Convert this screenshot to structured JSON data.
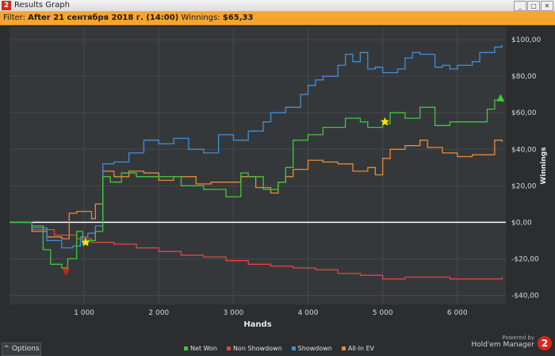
{
  "window": {
    "app_icon": "2",
    "title": "Results Graph",
    "buttons": [
      "_",
      "□",
      "✕"
    ]
  },
  "filter": {
    "label": "Filter:",
    "value": "After 21 сентября 2018 г. (14:00)",
    "winnings_label": "Winnings:",
    "winnings_value": "$65,33"
  },
  "bottom": {
    "options_label": "^ Options",
    "powered_by": "Powered by",
    "powered_name": "Hold'em Manager",
    "logo_glyph": "2"
  },
  "chart_data": {
    "type": "line",
    "xlabel": "Hands",
    "ylabel": "Winnings",
    "xlim": [
      0,
      6650
    ],
    "ylim": [
      -45,
      107
    ],
    "x_ticks": [
      1000,
      2000,
      3000,
      4000,
      5000,
      6000
    ],
    "x_tick_labels": [
      "1 000",
      "2 000",
      "3 000",
      "4 000",
      "5 000",
      "6 000"
    ],
    "y_ticks": [
      100,
      80,
      60,
      40,
      20,
      0,
      -20,
      -40
    ],
    "y_tick_labels": [
      "$100,00",
      "$80,00",
      "$60,00",
      "$40,00",
      "$20,00",
      "$0,00",
      "-$20,00",
      "-$40,00"
    ],
    "grid": true,
    "zero_line": true,
    "legend_position": "bottom",
    "series": [
      {
        "name": "Net Won",
        "color": "#3ec83a",
        "points": [
          [
            0,
            0
          ],
          [
            300,
            -2
          ],
          [
            450,
            -15
          ],
          [
            550,
            -23
          ],
          [
            700,
            -25
          ],
          [
            780,
            -20
          ],
          [
            900,
            -5
          ],
          [
            980,
            -12
          ],
          [
            1050,
            -10
          ],
          [
            1150,
            -5
          ],
          [
            1250,
            25
          ],
          [
            1350,
            22
          ],
          [
            1500,
            27
          ],
          [
            1700,
            25
          ],
          [
            2000,
            25
          ],
          [
            2300,
            20
          ],
          [
            2600,
            18
          ],
          [
            2900,
            14
          ],
          [
            3100,
            27
          ],
          [
            3200,
            25
          ],
          [
            3400,
            18
          ],
          [
            3600,
            22
          ],
          [
            3700,
            30
          ],
          [
            3800,
            45
          ],
          [
            4000,
            48
          ],
          [
            4200,
            52
          ],
          [
            4500,
            57
          ],
          [
            4700,
            55
          ],
          [
            4800,
            52
          ],
          [
            5000,
            54
          ],
          [
            5100,
            60
          ],
          [
            5300,
            57
          ],
          [
            5500,
            63
          ],
          [
            5700,
            53
          ],
          [
            5900,
            55
          ],
          [
            6200,
            55
          ],
          [
            6400,
            62
          ],
          [
            6500,
            67
          ],
          [
            6600,
            66
          ]
        ]
      },
      {
        "name": "Non Showdown",
        "color": "#e2463e",
        "points": [
          [
            0,
            0
          ],
          [
            300,
            -4
          ],
          [
            600,
            -7
          ],
          [
            900,
            -9
          ],
          [
            1100,
            -11
          ],
          [
            1400,
            -12
          ],
          [
            1700,
            -14
          ],
          [
            2000,
            -16
          ],
          [
            2300,
            -18
          ],
          [
            2600,
            -19
          ],
          [
            2900,
            -21
          ],
          [
            3200,
            -23
          ],
          [
            3500,
            -24
          ],
          [
            3800,
            -25
          ],
          [
            4100,
            -26
          ],
          [
            4400,
            -28
          ],
          [
            4700,
            -29
          ],
          [
            5000,
            -31
          ],
          [
            5300,
            -30
          ],
          [
            5600,
            -30
          ],
          [
            5900,
            -31
          ],
          [
            6200,
            -31
          ],
          [
            6400,
            -31
          ],
          [
            6600,
            -30
          ]
        ]
      },
      {
        "name": "Showdown",
        "color": "#3f8fd6",
        "points": [
          [
            0,
            0
          ],
          [
            300,
            -3
          ],
          [
            500,
            -10
          ],
          [
            700,
            -14
          ],
          [
            850,
            -13
          ],
          [
            950,
            -8
          ],
          [
            1050,
            -6
          ],
          [
            1150,
            -2
          ],
          [
            1250,
            32
          ],
          [
            1400,
            33
          ],
          [
            1600,
            38
          ],
          [
            1800,
            45
          ],
          [
            2000,
            43
          ],
          [
            2200,
            46
          ],
          [
            2400,
            40
          ],
          [
            2600,
            38
          ],
          [
            2800,
            48
          ],
          [
            3000,
            45
          ],
          [
            3200,
            50
          ],
          [
            3400,
            55
          ],
          [
            3500,
            60
          ],
          [
            3700,
            63
          ],
          [
            3900,
            70
          ],
          [
            4000,
            75
          ],
          [
            4100,
            78
          ],
          [
            4200,
            80
          ],
          [
            4400,
            86
          ],
          [
            4500,
            92
          ],
          [
            4600,
            88
          ],
          [
            4700,
            93
          ],
          [
            4800,
            84
          ],
          [
            4900,
            85
          ],
          [
            5000,
            82
          ],
          [
            5200,
            84
          ],
          [
            5300,
            90
          ],
          [
            5400,
            93
          ],
          [
            5500,
            92
          ],
          [
            5700,
            85
          ],
          [
            5800,
            86
          ],
          [
            5900,
            84
          ],
          [
            6000,
            86
          ],
          [
            6200,
            88
          ],
          [
            6300,
            93
          ],
          [
            6500,
            96
          ],
          [
            6600,
            97
          ]
        ]
      },
      {
        "name": "All-In EV",
        "color": "#e88a3a",
        "points": [
          [
            0,
            0
          ],
          [
            300,
            -5
          ],
          [
            500,
            -8
          ],
          [
            700,
            -9
          ],
          [
            800,
            5
          ],
          [
            900,
            6
          ],
          [
            1000,
            6
          ],
          [
            1100,
            2
          ],
          [
            1150,
            10
          ],
          [
            1250,
            28
          ],
          [
            1400,
            25
          ],
          [
            1600,
            28
          ],
          [
            1800,
            27
          ],
          [
            2000,
            23
          ],
          [
            2200,
            25
          ],
          [
            2500,
            21
          ],
          [
            2700,
            22
          ],
          [
            2900,
            22
          ],
          [
            3100,
            25
          ],
          [
            3300,
            19
          ],
          [
            3500,
            16
          ],
          [
            3600,
            22
          ],
          [
            3700,
            25
          ],
          [
            3800,
            29
          ],
          [
            4000,
            34
          ],
          [
            4200,
            33
          ],
          [
            4400,
            32
          ],
          [
            4600,
            28
          ],
          [
            4800,
            30
          ],
          [
            4900,
            26
          ],
          [
            5000,
            35
          ],
          [
            5100,
            40
          ],
          [
            5300,
            42
          ],
          [
            5500,
            45
          ],
          [
            5600,
            41
          ],
          [
            5800,
            38
          ],
          [
            6000,
            36
          ],
          [
            6200,
            37
          ],
          [
            6400,
            37
          ],
          [
            6500,
            45
          ],
          [
            6600,
            44
          ]
        ]
      }
    ],
    "markers": [
      {
        "series": "Net Won",
        "type": "triangle-up",
        "color": "#3ec83a",
        "x": 6580,
        "y": 68
      },
      {
        "series": "Net Won",
        "type": "triangle-down",
        "color": "#d81e1e",
        "x": 760,
        "y": -27
      },
      {
        "series": "Net Won",
        "type": "star",
        "color": "#ffe600",
        "x": 1020,
        "y": -11
      },
      {
        "series": "Net Won",
        "type": "star",
        "color": "#ffe600",
        "x": 5030,
        "y": 55
      }
    ]
  }
}
